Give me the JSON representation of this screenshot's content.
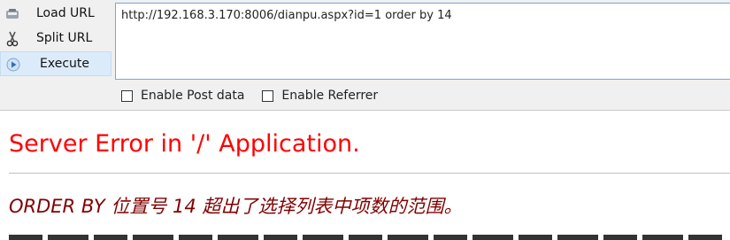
{
  "toolbar": {
    "load_url": "Load URL",
    "split_url": "Split URL",
    "execute": "Execute",
    "url_value": "http://192.168.3.170:8006/dianpu.aspx?id=1 order by 14",
    "enable_post": "Enable Post data",
    "enable_referrer": "Enable Referrer"
  },
  "page": {
    "error_title": "Server Error in '/' Application.",
    "error_message": "ORDER BY 位置号 14 超出了选择列表中项数的范围。"
  },
  "colors": {
    "title": "#ff0000",
    "message": "#800000",
    "active_bg": "#dcebfa"
  },
  "icons": [
    "load-url-icon",
    "scissors-icon",
    "play-icon"
  ]
}
